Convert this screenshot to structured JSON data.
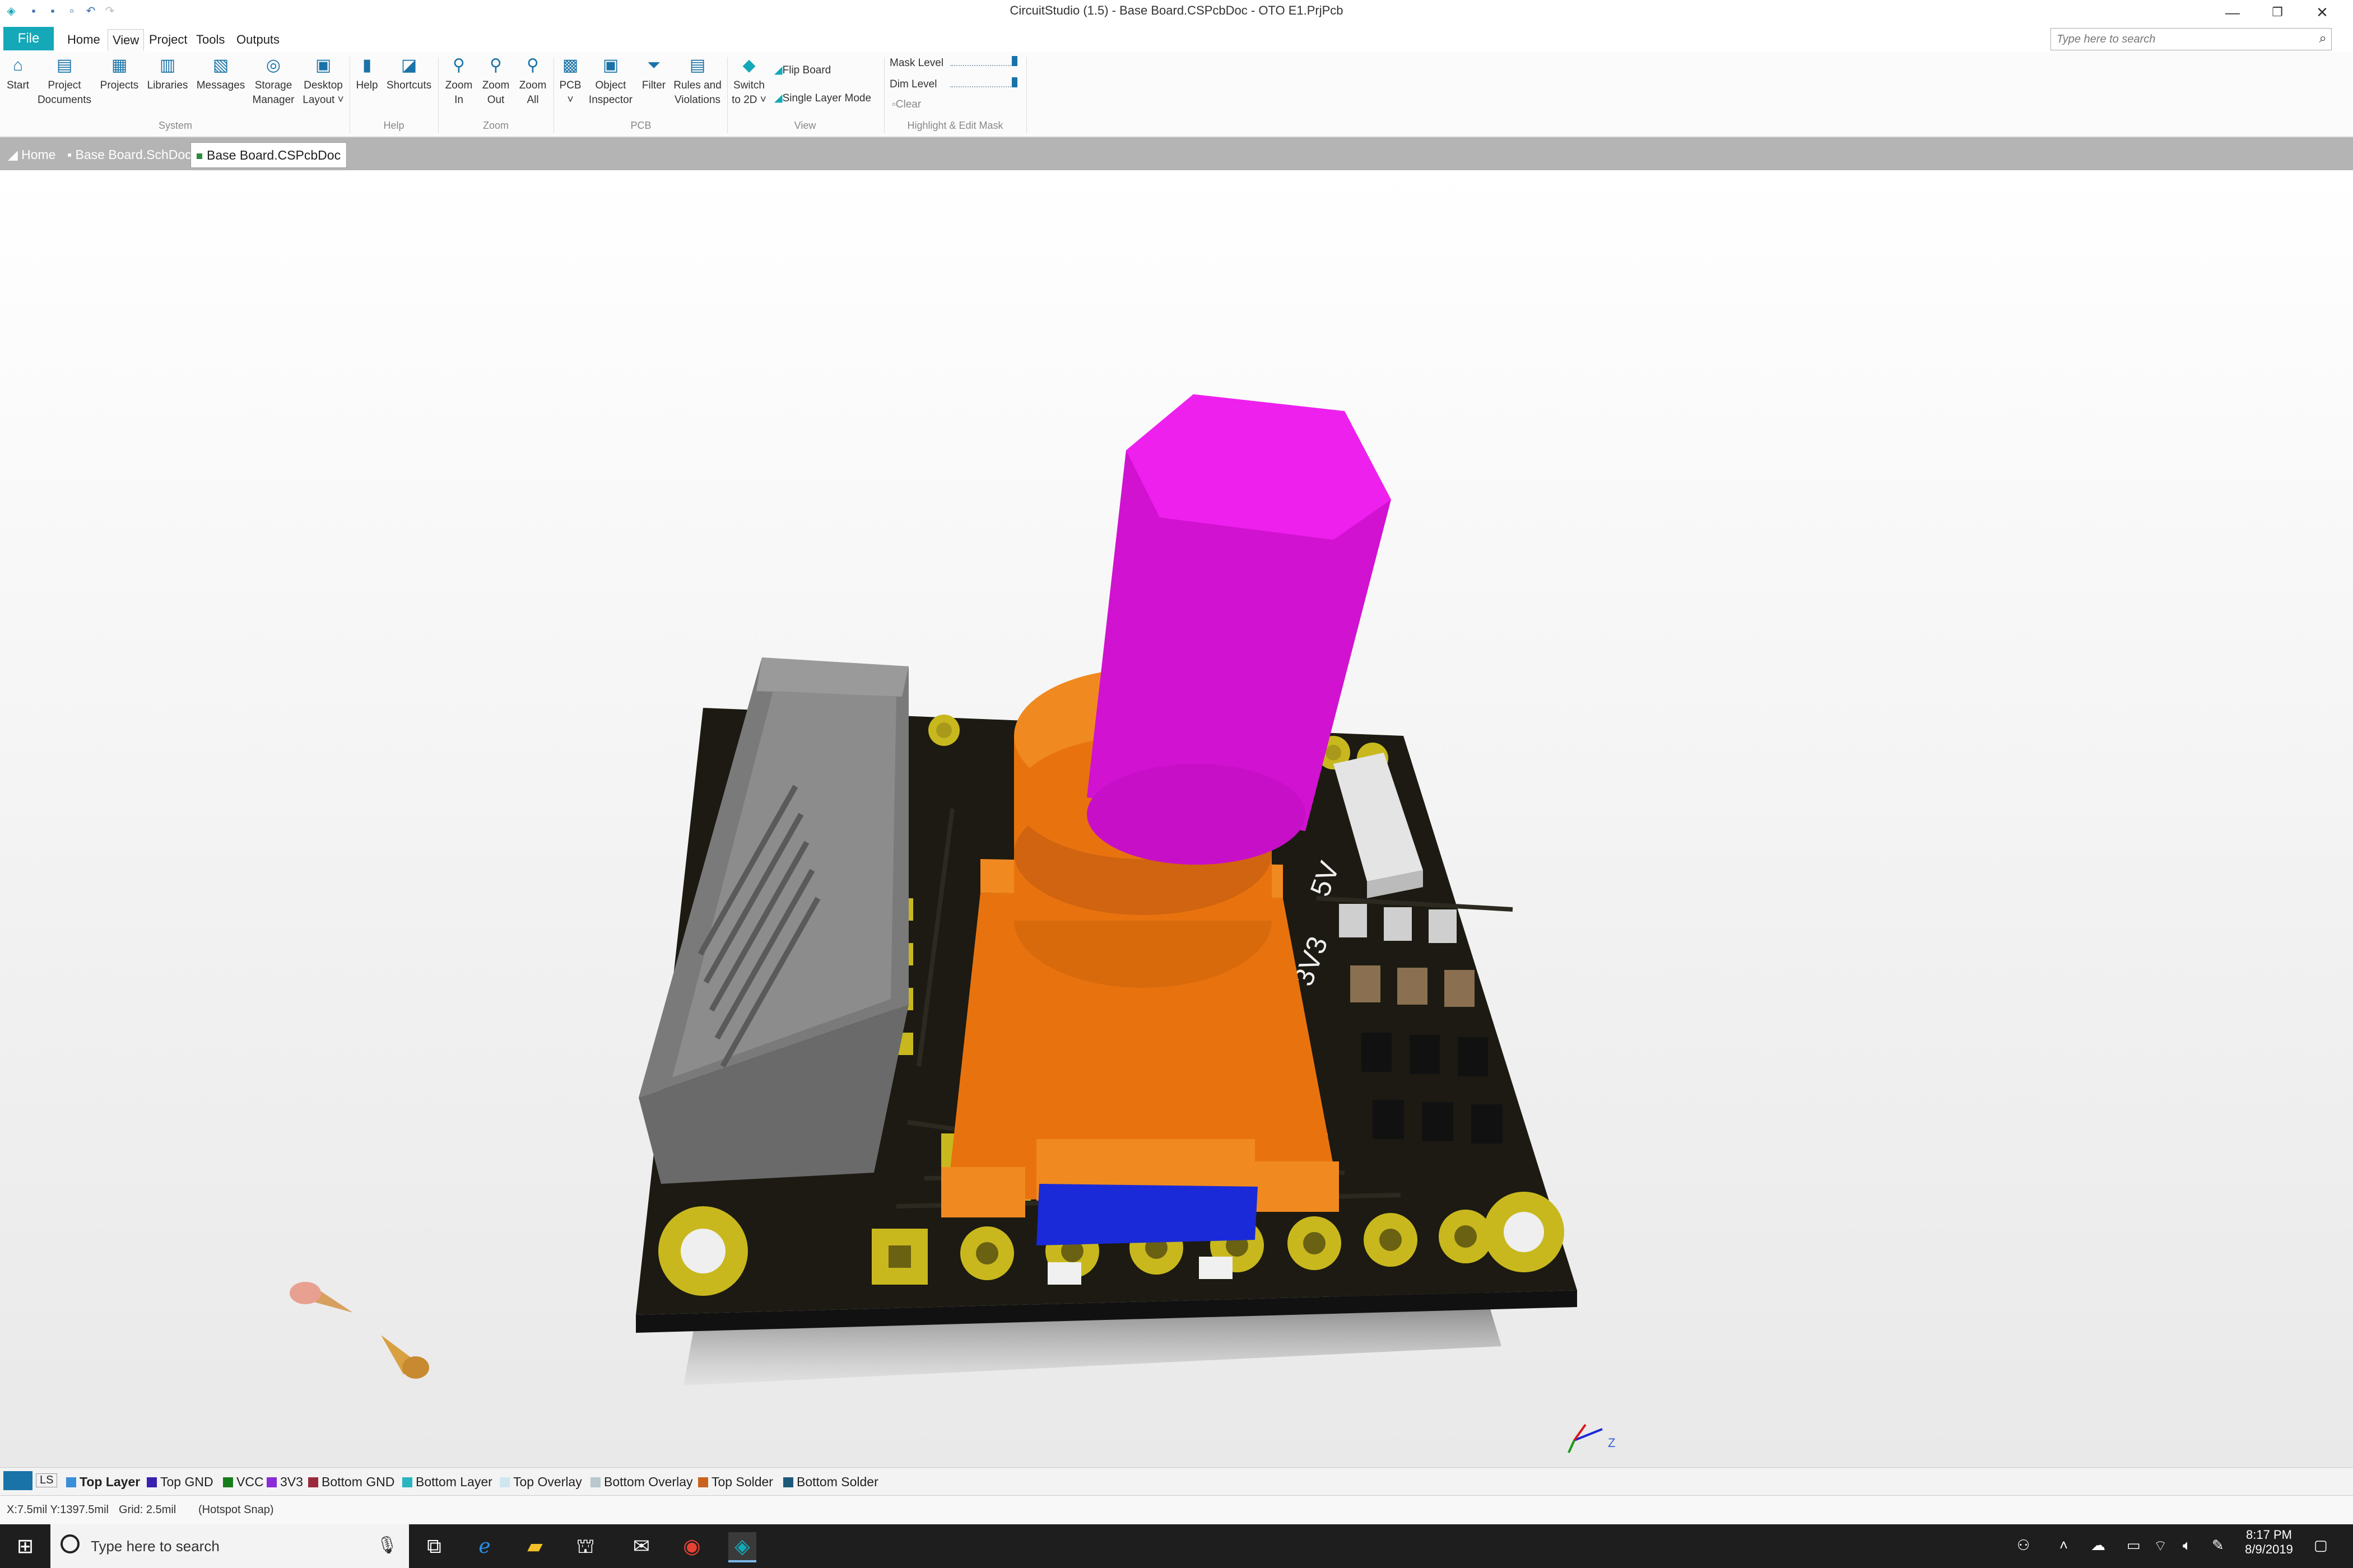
{
  "window": {
    "title": "CircuitStudio (1.5) - Base Board.CSPcbDoc - OTO E1.PrjPcb",
    "controls": [
      "—",
      "❐",
      "✕"
    ]
  },
  "menu": {
    "file": "File",
    "items": [
      "Home",
      "View",
      "Project",
      "Tools",
      "Outputs"
    ],
    "active": "View",
    "search_placeholder": "Type here to search"
  },
  "ribbon": {
    "buttons": [
      {
        "line1": "Start",
        "line2": "",
        "icon": "home-icon"
      },
      {
        "line1": "Project",
        "line2": "Documents",
        "icon": "documents-icon"
      },
      {
        "line1": "Projects",
        "line2": "",
        "icon": "projects-icon"
      },
      {
        "line1": "Libraries",
        "line2": "",
        "icon": "libraries-icon"
      },
      {
        "line1": "Messages",
        "line2": "",
        "icon": "messages-icon"
      },
      {
        "line1": "Storage",
        "line2": "Manager",
        "icon": "storage-icon"
      },
      {
        "line1": "Desktop",
        "line2": "Layout ˅",
        "icon": "layout-icon"
      },
      {
        "line1": "Help",
        "line2": "",
        "icon": "help-icon"
      },
      {
        "line1": "Shortcuts",
        "line2": "",
        "icon": "shortcuts-icon"
      },
      {
        "line1": "Zoom",
        "line2": "In",
        "icon": "zoom-in-icon"
      },
      {
        "line1": "Zoom",
        "line2": "Out",
        "icon": "zoom-out-icon"
      },
      {
        "line1": "Zoom",
        "line2": "All",
        "icon": "zoom-all-icon"
      },
      {
        "line1": "PCB",
        "line2": "˅",
        "icon": "pcb-icon"
      },
      {
        "line1": "Object",
        "line2": "Inspector",
        "icon": "inspector-icon"
      },
      {
        "line1": "Filter",
        "line2": "",
        "icon": "filter-icon"
      },
      {
        "line1": "Rules and",
        "line2": "Violations",
        "icon": "rules-icon"
      },
      {
        "line1": "Switch",
        "line2": "to 2D ˅",
        "icon": "switch-2d-icon"
      }
    ],
    "groups": [
      "System",
      "Help",
      "Zoom",
      "PCB",
      "View",
      "Highlight & Edit Mask"
    ],
    "view_options": [
      "Flip Board",
      "Single Layer Mode"
    ],
    "mask": {
      "mask_level_label": "Mask Level",
      "dim_level_label": "Dim Level",
      "clear_label": "Clear"
    }
  },
  "tabs": [
    {
      "label": "Home"
    },
    {
      "label": "Base Board.SchDoc"
    },
    {
      "label": "Base Board.CSPcbDoc",
      "active": true
    }
  ],
  "board": {
    "silk_5v": "5V",
    "silk_3v3": "3V3",
    "axis_label": "Z"
  },
  "layers": [
    {
      "name": "LS",
      "color": "#ffffff"
    },
    {
      "name": "Top Layer",
      "color": "#3b8fd8",
      "active": true
    },
    {
      "name": "Top GND",
      "color": "#3a1fb0"
    },
    {
      "name": "VCC",
      "color": "#167d1c"
    },
    {
      "name": "3V3",
      "color": "#8a2bd8"
    },
    {
      "name": "Bottom GND",
      "color": "#9a2a3a"
    },
    {
      "name": "Bottom Layer",
      "color": "#2bb5c0"
    },
    {
      "name": "Top Overlay",
      "color": "#cfe6ee"
    },
    {
      "name": "Bottom Overlay",
      "color": "#b8c8cc"
    },
    {
      "name": "Top Solder",
      "color": "#c8641e"
    },
    {
      "name": "Bottom Solder",
      "color": "#1d5a7a"
    }
  ],
  "status": {
    "coords": "X:7.5mil Y:1397.5mil",
    "grid": "Grid: 2.5mil",
    "snap": "(Hotspot Snap)"
  },
  "taskbar": {
    "search_placeholder": "Type here to search",
    "time": "8:17 PM",
    "date": "8/9/2019"
  }
}
